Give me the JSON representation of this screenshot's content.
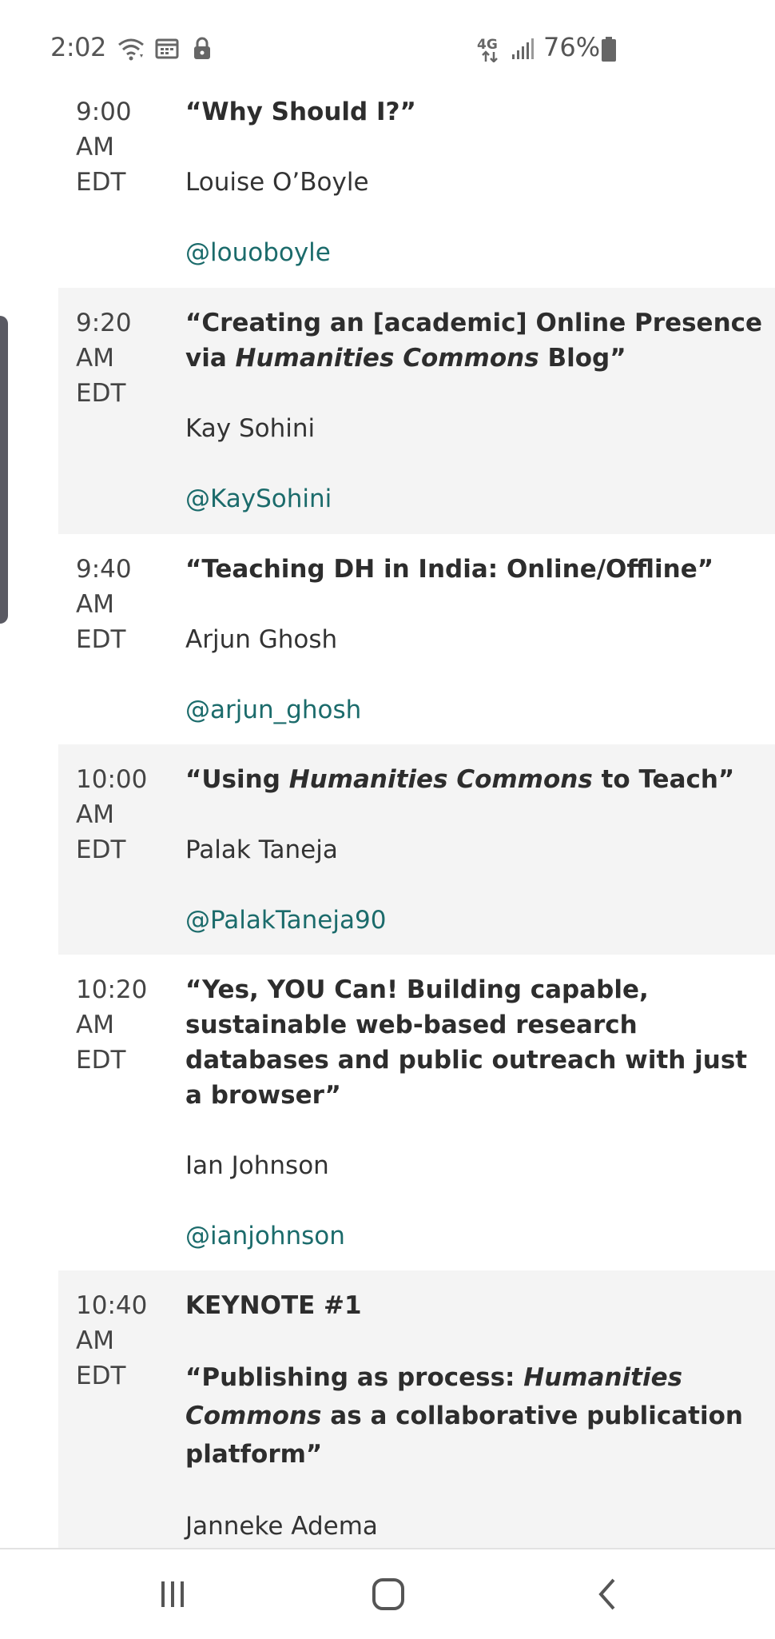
{
  "status_bar": {
    "time": "2:02",
    "network": "4G",
    "battery": "76%"
  },
  "icons": {
    "wifi": "wifi-icon",
    "calendar": "calendar-icon",
    "lock": "lock-icon",
    "network": "4g-icon",
    "signal": "signal-icon",
    "battery": "battery-icon",
    "recents": "recents-icon",
    "home": "home-icon",
    "back": "back-icon"
  },
  "schedule": [
    {
      "time": [
        "9:00",
        "AM",
        "EDT"
      ],
      "title_parts": [
        "“Why Should I?”"
      ],
      "speaker": "Louise O’Boyle",
      "handle": "@louoboyle"
    },
    {
      "time": [
        "9:20",
        "AM",
        "EDT"
      ],
      "title_parts": [
        "“Creating an [academic] Online Presence via ",
        "Humanities Commons",
        " Blog”"
      ],
      "speaker": "Kay Sohini",
      "handle": "@KaySohini"
    },
    {
      "time": [
        "9:40",
        "AM",
        "EDT"
      ],
      "title_parts": [
        "“Teaching DH in India: Online/Offline”"
      ],
      "speaker": "Arjun Ghosh",
      "handle": "@arjun_ghosh"
    },
    {
      "time": [
        "10:00",
        "AM",
        "EDT"
      ],
      "title_parts": [
        "“Using ",
        "Humanities Commons",
        " to Teach”"
      ],
      "speaker": "Palak Taneja",
      "handle": "@PalakTaneja90"
    },
    {
      "time": [
        "10:20",
        "AM",
        "EDT"
      ],
      "title_parts": [
        "“Yes, YOU Can! Building capable, sustainable web-based research databases and public outreach with just a browser”"
      ],
      "speaker": "Ian Johnson",
      "handle": "@ianjohnson"
    },
    {
      "time": [
        "10:40",
        "AM",
        "EDT"
      ],
      "label": "KEYNOTE #1",
      "title_parts": [
        "“Publishing as process: ",
        "Humanities Commons",
        " as a collaborative publication platform”"
      ],
      "speaker": "Janneke Adema"
    }
  ]
}
